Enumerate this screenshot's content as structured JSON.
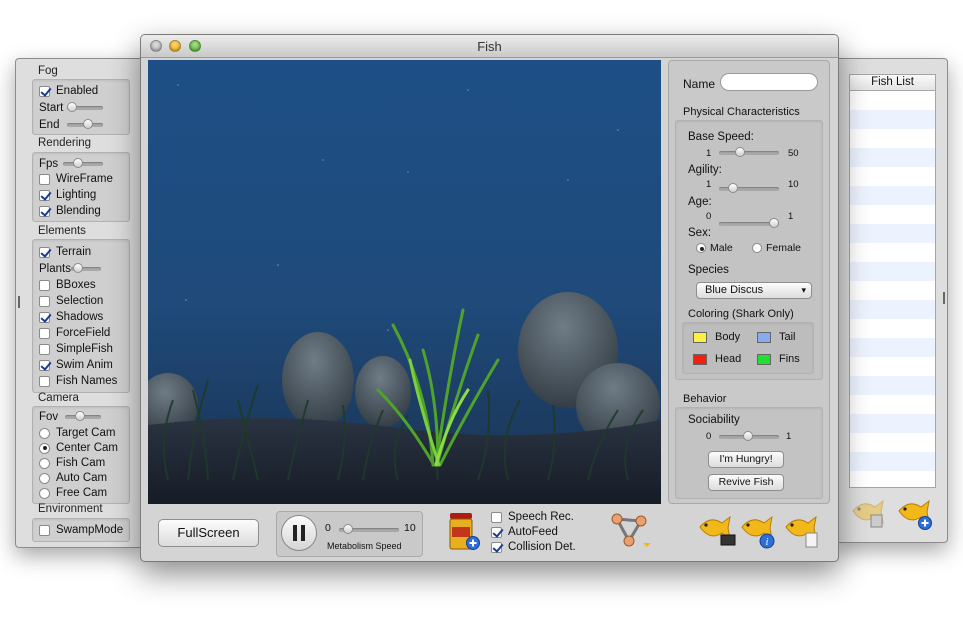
{
  "main_window": {
    "title": "Fish"
  },
  "left_panel": {
    "fog": {
      "header": "Fog",
      "enabled_label": "Enabled",
      "enabled": true,
      "start_label": "Start",
      "end_label": "End"
    },
    "rendering": {
      "header": "Rendering",
      "fps_label": "Fps",
      "wireframe_label": "WireFrame",
      "lighting_label": "Lighting",
      "blending_label": "Blending"
    },
    "elements": {
      "header": "Elements",
      "terrain_label": "Terrain",
      "plants_label": "Plants",
      "bboxes_label": "BBoxes",
      "selection_label": "Selection",
      "shadows_label": "Shadows",
      "forcefield_label": "ForceField",
      "simplefish_label": "SimpleFish",
      "swimanim_label": "Swim Anim",
      "fishnames_label": "Fish Names"
    },
    "camera": {
      "header": "Camera",
      "fov_label": "Fov",
      "target_label": "Target Cam",
      "center_label": "Center Cam",
      "fish_label": "Fish Cam",
      "auto_label": "Auto Cam",
      "free_label": "Free Cam",
      "selected": "Center Cam"
    },
    "environment": {
      "header": "Environment",
      "swamp_label": "SwampMode"
    }
  },
  "right_panel": {
    "name_label": "Name",
    "name_value": "",
    "physical_header": "Physical Characteristics",
    "base_speed": {
      "label": "Base Speed:",
      "min": "1",
      "max": "50"
    },
    "agility": {
      "label": "Agility:",
      "min": "1",
      "max": "10"
    },
    "age": {
      "label": "Age:",
      "min": "0",
      "max": "1"
    },
    "sex": {
      "label": "Sex:",
      "male": "Male",
      "female": "Female",
      "selected": "Male"
    },
    "species": {
      "label": "Species",
      "value": "Blue Discus"
    },
    "coloring": {
      "header": "Coloring (Shark Only)",
      "body": "Body",
      "tail": "Tail",
      "head": "Head",
      "fins": "Fins",
      "body_color": "#ffee44",
      "tail_color": "#88aaee",
      "head_color": "#ee2211",
      "fins_color": "#22dd33"
    },
    "behavior_header": "Behavior",
    "sociability": {
      "label": "Sociability",
      "min": "0",
      "max": "1"
    },
    "hungry_button": "I'm Hungry!",
    "revive_button": "Revive Fish"
  },
  "bottom_bar": {
    "fullscreen_button": "FullScreen",
    "metabolism": {
      "min": "0",
      "max": "10",
      "label": "Metabolism Speed"
    },
    "speech_label": "Speech Rec.",
    "autofeed_label": "AutoFeed",
    "collision_label": "Collision Det."
  },
  "fish_list": {
    "header": "Fish List"
  }
}
